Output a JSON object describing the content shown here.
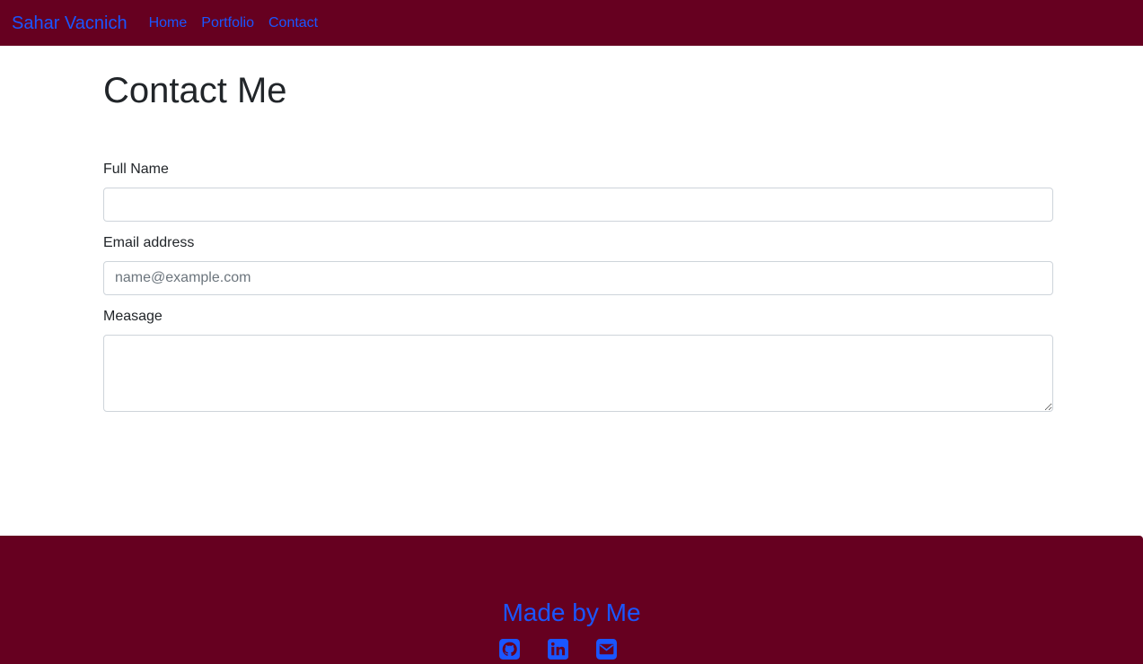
{
  "navbar": {
    "brand": "Sahar Vacnich",
    "links": [
      "Home",
      "Portfolio",
      "Contact"
    ]
  },
  "page": {
    "title": "Contact Me"
  },
  "form": {
    "full_name": {
      "label": "Full Name",
      "value": "",
      "placeholder": ""
    },
    "email": {
      "label": "Email address",
      "value": "",
      "placeholder": "name@example.com"
    },
    "message": {
      "label": "Measage",
      "value": ""
    }
  },
  "footer": {
    "title": "Made by Me",
    "icons": [
      "github-icon",
      "linkedin-icon",
      "envelope-icon"
    ]
  },
  "colors": {
    "nav_background": "#660020",
    "link": "#1a56ff"
  }
}
